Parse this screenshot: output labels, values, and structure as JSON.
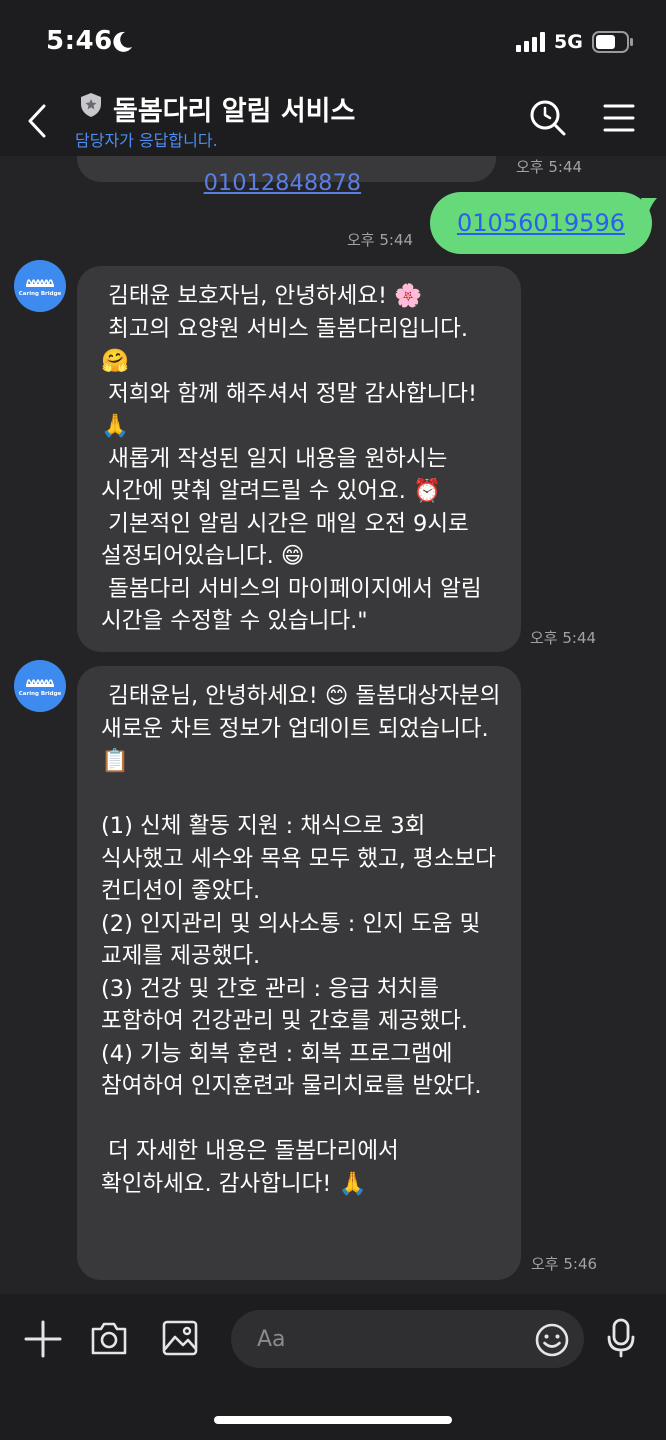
{
  "status_bar": {
    "time": "5:46",
    "network": "5G",
    "icons": [
      "moon-icon",
      "signal-icon",
      "battery-icon"
    ]
  },
  "header": {
    "title": "돌봄다리 알림 서비스",
    "subtitle": "담당자가 응답합니다.",
    "icons": [
      "back-icon",
      "shield-icon",
      "search-icon",
      "menu-icon"
    ],
    "subtitle_color": "#4d8df0"
  },
  "chat": {
    "prev_message": {
      "visible_text": "01012848878",
      "time": "오후 5:44"
    },
    "sent_message": {
      "text": "01056019596",
      "time": "오후 5:44",
      "bubble_color": "#66d97a"
    },
    "avatar_caption": "Caring Bridge",
    "messages": [
      {
        "text": " 김태윤 보호자님, 안녕하세요! 🌸\n 최고의 요양원 서비스 돌봄다리입니다. 🤗\n 저희와 함께 해주셔서 정말 감사합니다! 🙏\n 새롭게 작성된 일지 내용을 원하시는 시간에 맞춰 알려드릴 수 있어요. ⏰\n 기본적인 알림 시간은 매일 오전 9시로 설정되어있습니다. 😄\n 돌봄다리 서비스의 마이페이지에서 알림 시간을 수정할 수 있습니다.\"",
        "time": "오후 5:44"
      },
      {
        "text": " 김태윤님, 안녕하세요! 😊 돌봄대상자분의 새로운 차트 정보가 업데이트 되었습니다. 📋\n\n(1) 신체 활동 지원 : 채식으로 3회 식사했고 세수와 목욕 모두 했고, 평소보다 컨디션이 좋았다.\n(2) 인지관리 및 의사소통 : 인지 도움 및 교제를 제공했다.\n(3) 건강 및 간호 관리 : 응급 처치를 포함하여 건강관리 및 간호를 제공했다.\n(4) 기능 회복 훈련 : 회복 프로그램에 참여하여 인지훈련과 물리치료를 받았다.\n\n 더 자세한 내용은 돌봄다리에서 확인하세요. 감사합니다! 🙏",
        "time": "오후 5:46"
      }
    ]
  },
  "input_bar": {
    "placeholder": "Aa",
    "icons": [
      "plus-icon",
      "camera-icon",
      "gallery-icon",
      "emoji-icon",
      "mic-icon"
    ]
  },
  "colors": {
    "background": "#1d1d1f",
    "chat_background": "#242426",
    "bubble_received": "#39393b",
    "accent": "#4d8df0"
  }
}
